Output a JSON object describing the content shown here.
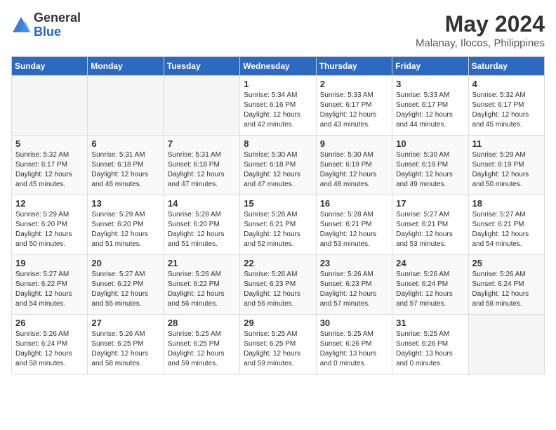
{
  "app": {
    "logo_general": "General",
    "logo_blue": "Blue"
  },
  "header": {
    "title": "May 2024",
    "location": "Malanay, Ilocos, Philippines"
  },
  "weekdays": [
    "Sunday",
    "Monday",
    "Tuesday",
    "Wednesday",
    "Thursday",
    "Friday",
    "Saturday"
  ],
  "weeks": [
    [
      {
        "day": "",
        "sunrise": "",
        "sunset": "",
        "daylight": ""
      },
      {
        "day": "",
        "sunrise": "",
        "sunset": "",
        "daylight": ""
      },
      {
        "day": "",
        "sunrise": "",
        "sunset": "",
        "daylight": ""
      },
      {
        "day": "1",
        "sunrise": "Sunrise: 5:34 AM",
        "sunset": "Sunset: 6:16 PM",
        "daylight": "Daylight: 12 hours and 42 minutes."
      },
      {
        "day": "2",
        "sunrise": "Sunrise: 5:33 AM",
        "sunset": "Sunset: 6:17 PM",
        "daylight": "Daylight: 12 hours and 43 minutes."
      },
      {
        "day": "3",
        "sunrise": "Sunrise: 5:33 AM",
        "sunset": "Sunset: 6:17 PM",
        "daylight": "Daylight: 12 hours and 44 minutes."
      },
      {
        "day": "4",
        "sunrise": "Sunrise: 5:32 AM",
        "sunset": "Sunset: 6:17 PM",
        "daylight": "Daylight: 12 hours and 45 minutes."
      }
    ],
    [
      {
        "day": "5",
        "sunrise": "Sunrise: 5:32 AM",
        "sunset": "Sunset: 6:17 PM",
        "daylight": "Daylight: 12 hours and 45 minutes."
      },
      {
        "day": "6",
        "sunrise": "Sunrise: 5:31 AM",
        "sunset": "Sunset: 6:18 PM",
        "daylight": "Daylight: 12 hours and 46 minutes."
      },
      {
        "day": "7",
        "sunrise": "Sunrise: 5:31 AM",
        "sunset": "Sunset: 6:18 PM",
        "daylight": "Daylight: 12 hours and 47 minutes."
      },
      {
        "day": "8",
        "sunrise": "Sunrise: 5:30 AM",
        "sunset": "Sunset: 6:18 PM",
        "daylight": "Daylight: 12 hours and 47 minutes."
      },
      {
        "day": "9",
        "sunrise": "Sunrise: 5:30 AM",
        "sunset": "Sunset: 6:19 PM",
        "daylight": "Daylight: 12 hours and 48 minutes."
      },
      {
        "day": "10",
        "sunrise": "Sunrise: 5:30 AM",
        "sunset": "Sunset: 6:19 PM",
        "daylight": "Daylight: 12 hours and 49 minutes."
      },
      {
        "day": "11",
        "sunrise": "Sunrise: 5:29 AM",
        "sunset": "Sunset: 6:19 PM",
        "daylight": "Daylight: 12 hours and 50 minutes."
      }
    ],
    [
      {
        "day": "12",
        "sunrise": "Sunrise: 5:29 AM",
        "sunset": "Sunset: 6:20 PM",
        "daylight": "Daylight: 12 hours and 50 minutes."
      },
      {
        "day": "13",
        "sunrise": "Sunrise: 5:29 AM",
        "sunset": "Sunset: 6:20 PM",
        "daylight": "Daylight: 12 hours and 51 minutes."
      },
      {
        "day": "14",
        "sunrise": "Sunrise: 5:28 AM",
        "sunset": "Sunset: 6:20 PM",
        "daylight": "Daylight: 12 hours and 51 minutes."
      },
      {
        "day": "15",
        "sunrise": "Sunrise: 5:28 AM",
        "sunset": "Sunset: 6:21 PM",
        "daylight": "Daylight: 12 hours and 52 minutes."
      },
      {
        "day": "16",
        "sunrise": "Sunrise: 5:28 AM",
        "sunset": "Sunset: 6:21 PM",
        "daylight": "Daylight: 12 hours and 53 minutes."
      },
      {
        "day": "17",
        "sunrise": "Sunrise: 5:27 AM",
        "sunset": "Sunset: 6:21 PM",
        "daylight": "Daylight: 12 hours and 53 minutes."
      },
      {
        "day": "18",
        "sunrise": "Sunrise: 5:27 AM",
        "sunset": "Sunset: 6:21 PM",
        "daylight": "Daylight: 12 hours and 54 minutes."
      }
    ],
    [
      {
        "day": "19",
        "sunrise": "Sunrise: 5:27 AM",
        "sunset": "Sunset: 6:22 PM",
        "daylight": "Daylight: 12 hours and 54 minutes."
      },
      {
        "day": "20",
        "sunrise": "Sunrise: 5:27 AM",
        "sunset": "Sunset: 6:22 PM",
        "daylight": "Daylight: 12 hours and 55 minutes."
      },
      {
        "day": "21",
        "sunrise": "Sunrise: 5:26 AM",
        "sunset": "Sunset: 6:22 PM",
        "daylight": "Daylight: 12 hours and 56 minutes."
      },
      {
        "day": "22",
        "sunrise": "Sunrise: 5:26 AM",
        "sunset": "Sunset: 6:23 PM",
        "daylight": "Daylight: 12 hours and 56 minutes."
      },
      {
        "day": "23",
        "sunrise": "Sunrise: 5:26 AM",
        "sunset": "Sunset: 6:23 PM",
        "daylight": "Daylight: 12 hours and 57 minutes."
      },
      {
        "day": "24",
        "sunrise": "Sunrise: 5:26 AM",
        "sunset": "Sunset: 6:24 PM",
        "daylight": "Daylight: 12 hours and 57 minutes."
      },
      {
        "day": "25",
        "sunrise": "Sunrise: 5:26 AM",
        "sunset": "Sunset: 6:24 PM",
        "daylight": "Daylight: 12 hours and 58 minutes."
      }
    ],
    [
      {
        "day": "26",
        "sunrise": "Sunrise: 5:26 AM",
        "sunset": "Sunset: 6:24 PM",
        "daylight": "Daylight: 12 hours and 58 minutes."
      },
      {
        "day": "27",
        "sunrise": "Sunrise: 5:26 AM",
        "sunset": "Sunset: 6:25 PM",
        "daylight": "Daylight: 12 hours and 58 minutes."
      },
      {
        "day": "28",
        "sunrise": "Sunrise: 5:25 AM",
        "sunset": "Sunset: 6:25 PM",
        "daylight": "Daylight: 12 hours and 59 minutes."
      },
      {
        "day": "29",
        "sunrise": "Sunrise: 5:25 AM",
        "sunset": "Sunset: 6:25 PM",
        "daylight": "Daylight: 12 hours and 59 minutes."
      },
      {
        "day": "30",
        "sunrise": "Sunrise: 5:25 AM",
        "sunset": "Sunset: 6:26 PM",
        "daylight": "Daylight: 13 hours and 0 minutes."
      },
      {
        "day": "31",
        "sunrise": "Sunrise: 5:25 AM",
        "sunset": "Sunset: 6:26 PM",
        "daylight": "Daylight: 13 hours and 0 minutes."
      },
      {
        "day": "",
        "sunrise": "",
        "sunset": "",
        "daylight": ""
      }
    ]
  ]
}
